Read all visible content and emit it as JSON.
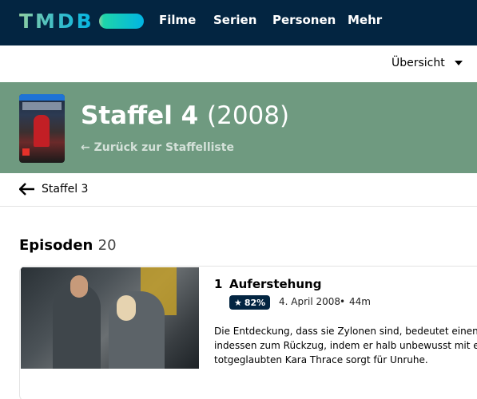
{
  "nav": {
    "logo": "TMDB",
    "items": [
      "Filme",
      "Serien",
      "Personen",
      "Mehr"
    ]
  },
  "submenu": {
    "overview_label": "Übersicht"
  },
  "season": {
    "title": "Staffel 4",
    "year": "(2008)",
    "back_label": "← Zurück zur Staffelliste",
    "prev_season": "Staffel 3"
  },
  "episodes": {
    "heading": "Episoden",
    "count": "20",
    "items": [
      {
        "number": "1",
        "title": "Auferstehung",
        "rating": "82%",
        "date": "4. April 2008",
        "runtime": "44m",
        "overview_lines": [
          "Die Entdeckung, dass sie Zylonen sind, bedeutet einen ri",
          "indessen zum Rückzug, indem er halb unbewusst mit eir",
          "totgeglaubten Kara Thrace sorgt für Unruhe."
        ]
      }
    ]
  },
  "colors": {
    "nav_bg": "#032541",
    "band_bg": "#6f9a80",
    "rating_bg": "#032541"
  }
}
